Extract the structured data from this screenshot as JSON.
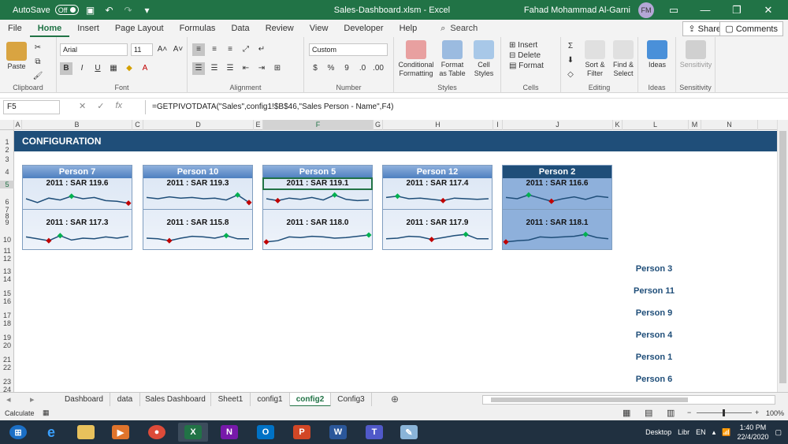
{
  "titlebar": {
    "autosave_label": "AutoSave",
    "autosave_state": "Off",
    "file_name": "Sales-Dashboard.xlsm - Excel",
    "user_name": "Fahad Mohammad Al-Garni",
    "user_initials": "FM"
  },
  "ribbon_tabs": [
    "File",
    "Home",
    "Insert",
    "Page Layout",
    "Formulas",
    "Data",
    "Review",
    "View",
    "Developer",
    "Help"
  ],
  "search_label": "Search",
  "share_label": "Share",
  "comments_label": "Comments",
  "ribbon": {
    "clipboard": {
      "paste": "Paste",
      "label": "Clipboard"
    },
    "font": {
      "name": "Arial",
      "size": "11",
      "label": "Font"
    },
    "alignment": {
      "label": "Alignment"
    },
    "number": {
      "format": "Custom",
      "label": "Number"
    },
    "styles": {
      "conditional": "Conditional Formatting",
      "format_table": "Format as Table",
      "cell_styles": "Cell Styles",
      "label": "Styles"
    },
    "cells": {
      "insert": "Insert",
      "delete": "Delete",
      "format": "Format",
      "label": "Cells"
    },
    "editing": {
      "sort": "Sort & Filter",
      "find": "Find & Select",
      "label": "Editing"
    },
    "ideas": {
      "btn": "Ideas",
      "label": "Ideas"
    },
    "sensitivity": {
      "btn": "Sensitivity",
      "label": "Sensitivity"
    }
  },
  "formula_bar": {
    "cell_ref": "F5",
    "formula": "=GETPIVOTDATA(\"Sales\",config1!$B$46,\"Sales Person - Name\",F4)"
  },
  "columns": [
    "A",
    "B",
    "C",
    "D",
    "E",
    "F",
    "G",
    "H",
    "I",
    "J",
    "K",
    "L",
    "M",
    "N"
  ],
  "rows": [
    "1",
    "2",
    "3",
    "4",
    "5",
    "6",
    "7",
    "8",
    "9",
    "10",
    "11",
    "12",
    "13",
    "14",
    "15",
    "16",
    "17",
    "18",
    "19",
    "20",
    "21",
    "22",
    "23",
    "24"
  ],
  "banner_title": "CONFIGURATION",
  "cards": [
    {
      "person": "Person 7",
      "top": "2011 : SAR 119.6",
      "bottom": "2011 : SAR 117.3",
      "spark1": [
        0.5,
        0.2,
        0.55,
        0.4,
        0.7,
        0.5,
        0.6,
        0.35,
        0.3,
        0.15
      ],
      "spark2": [
        0.6,
        0.45,
        0.3,
        0.7,
        0.35,
        0.5,
        0.45,
        0.6,
        0.5,
        0.65
      ]
    },
    {
      "person": "Person 10",
      "top": "2011 : SAR 119.3",
      "bottom": "2011 : SAR 115.8",
      "spark1": [
        0.6,
        0.5,
        0.65,
        0.55,
        0.6,
        0.5,
        0.55,
        0.4,
        0.8,
        0.2
      ],
      "spark2": [
        0.5,
        0.45,
        0.3,
        0.5,
        0.65,
        0.6,
        0.5,
        0.7,
        0.45,
        0.45
      ]
    },
    {
      "person": "Person 5",
      "top": "2011 : SAR 119.1",
      "bottom": "2011 : SAR 118.0",
      "spark1": [
        0.5,
        0.35,
        0.55,
        0.45,
        0.6,
        0.4,
        0.8,
        0.45,
        0.35,
        0.4
      ],
      "spark2": [
        0.2,
        0.3,
        0.6,
        0.55,
        0.65,
        0.6,
        0.5,
        0.55,
        0.65,
        0.75
      ]
    },
    {
      "person": "Person 12",
      "top": "2011 : SAR 117.4",
      "bottom": "2011 : SAR 117.9",
      "spark1": [
        0.6,
        0.7,
        0.5,
        0.55,
        0.45,
        0.35,
        0.55,
        0.5,
        0.45,
        0.5
      ],
      "spark2": [
        0.45,
        0.5,
        0.65,
        0.6,
        0.4,
        0.55,
        0.7,
        0.8,
        0.45,
        0.45
      ]
    },
    {
      "person": "Person 2",
      "top": "2011 : SAR 116.6",
      "bottom": "2011 : SAR 118.1",
      "spark1": [
        0.6,
        0.5,
        0.8,
        0.55,
        0.3,
        0.5,
        0.65,
        0.45,
        0.7,
        0.6
      ],
      "spark2": [
        0.2,
        0.3,
        0.35,
        0.6,
        0.55,
        0.6,
        0.65,
        0.8,
        0.55,
        0.45
      ]
    }
  ],
  "person_list": [
    "Person 3",
    "Person 11",
    "Person 9",
    "Person 4",
    "Person 1",
    "Person 6"
  ],
  "sheet_tabs": [
    "Dashboard",
    "data",
    "Sales Dashboard",
    "Sheet1",
    "config1",
    "config2",
    "Config3"
  ],
  "status": {
    "mode": "Calculate",
    "zoom": "100%"
  },
  "taskbar": {
    "desktop": "Desktop",
    "libr": "Libr",
    "lang": "EN",
    "time": "1:40 PM",
    "date": "22/4/2020"
  },
  "colors": {
    "excel_green": "#217346",
    "banner": "#1f4e79",
    "spark_line": "#1f4e79",
    "marker_high": "#00b050",
    "marker_low": "#c00000"
  }
}
